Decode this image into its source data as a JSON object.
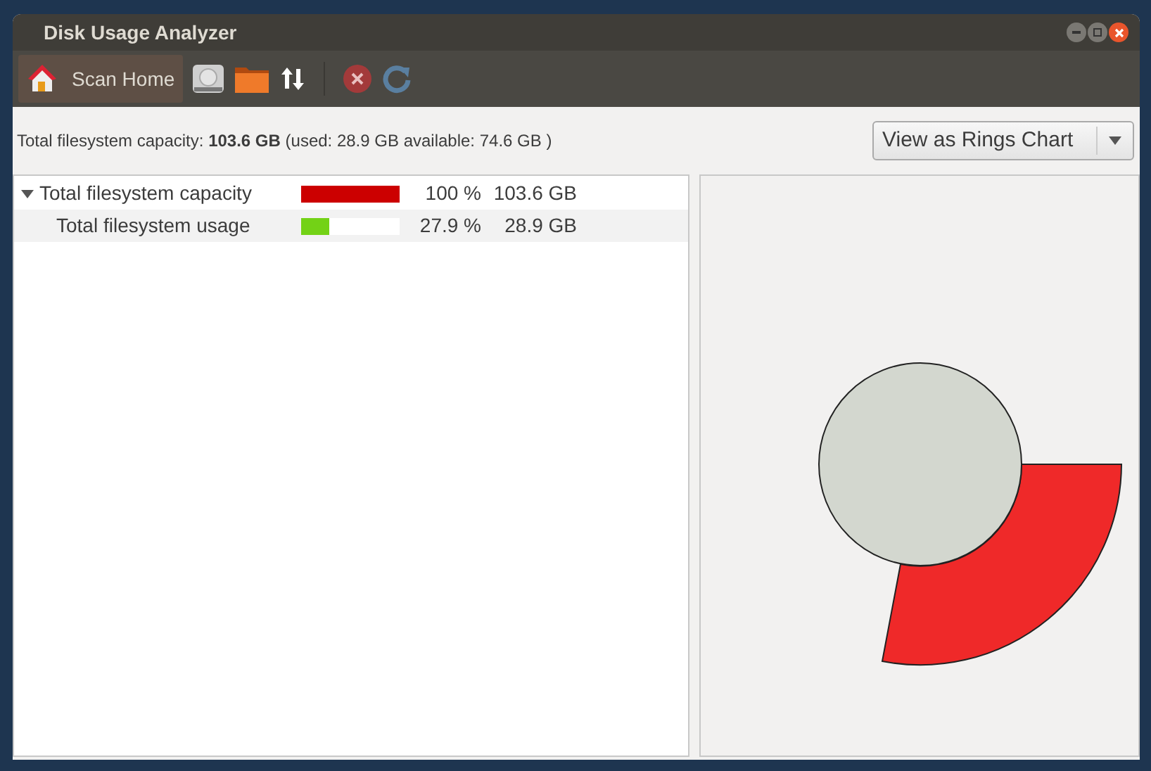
{
  "window": {
    "title": "Disk Usage Analyzer"
  },
  "toolbar": {
    "scan_home": {
      "label": "Scan Home",
      "selected": true
    }
  },
  "summary": "Total filesystem capacity: **103.6 GB** (used: 28.9 GB available: 74.6 GB )",
  "view_selector": {
    "value": "View as Rings Chart"
  },
  "tree": [
    {
      "name": "Total filesystem capacity",
      "level": 1.0,
      "color": "#cc0000",
      "percent": "100 %",
      "size": "103.6 GB",
      "expanded": true,
      "children": [
        {
          "name": "Total filesystem usage",
          "level": 0.279,
          "color": "#73d216",
          "percent": "27.9 %",
          "size": "28.9 GB"
        }
      ]
    }
  ]
}
